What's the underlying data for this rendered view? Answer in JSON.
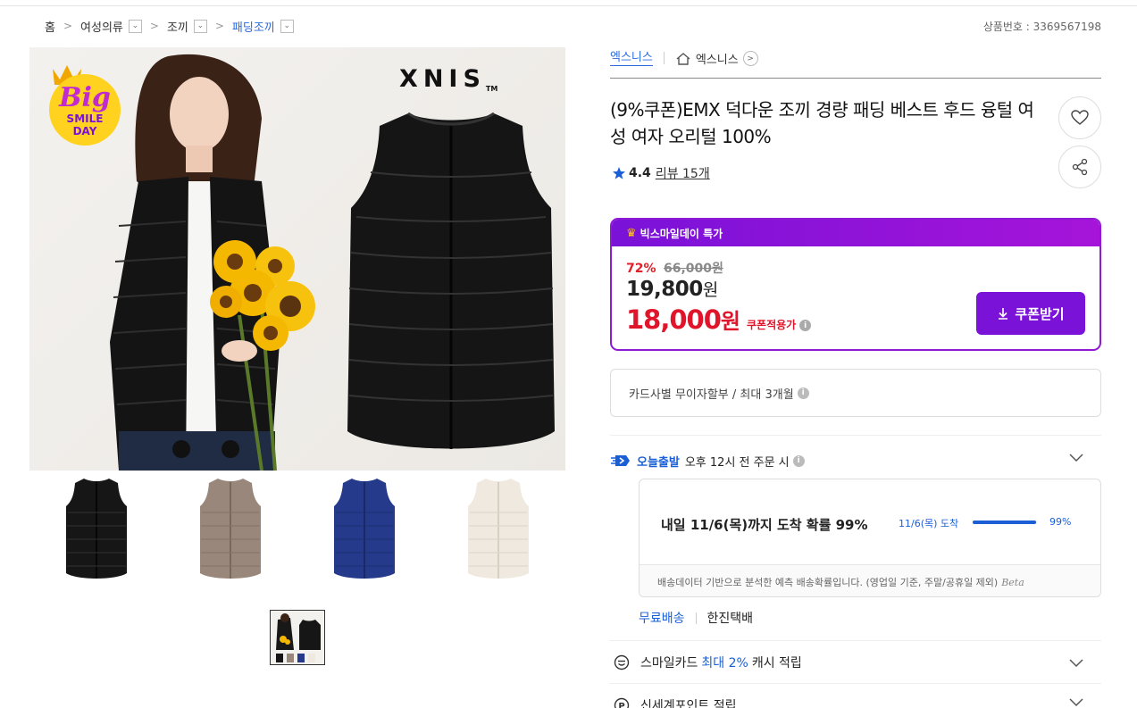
{
  "breadcrumb": {
    "home": "홈",
    "cat1": "여성의류",
    "cat2": "조끼",
    "cat3": "패딩조끼"
  },
  "product_no": "상품번호 : 3369567198",
  "image": {
    "brand": "XNIS",
    "tm": "TM",
    "badge_line1": "Big",
    "badge_line2": "SMILE",
    "badge_line3": "DAY"
  },
  "seller": {
    "shop": "엑스니스",
    "store": "엑스니스"
  },
  "product": {
    "title": "(9%쿠폰)EMX 덕다운 조끼 경량 패딩 베스트 후드 융털 여성 여자 오리털 100%",
    "rating": "4.4",
    "reviews": "리뷰 15개"
  },
  "price": {
    "event": "빅스마일데이 특가",
    "discount_pct": "72%",
    "original": "66,000원",
    "sale_amount": "19,800",
    "sale_unit": "원",
    "coupon_amount": "18,000",
    "coupon_unit": "원",
    "coupon_note": "쿠폰적용가",
    "coupon_button": "쿠폰받기"
  },
  "installment": "카드사별 무이자할부 / 최대 3개월",
  "shipping": {
    "today_label": "오늘출발",
    "cutoff": "오후 12시 전 주문 시",
    "arrival_line": "내일 11/6(목)까지 도착 확률 99%",
    "arrival_short": "11/6(목) 도착",
    "probability": 0.99,
    "probability_label": "99%",
    "note": "배송데이터 기반으로 분석한 예측 배송확률입니다. (영업일 기준, 주말/공휴일 제외)",
    "beta": "Beta",
    "free": "무료배송",
    "carrier": "한진택배"
  },
  "benefits": [
    {
      "pre": "스마일카드",
      "hl": "최대 2%",
      "post": "캐시 적립"
    },
    {
      "pre": "신세계포인트 적립",
      "hl": "",
      "post": ""
    }
  ],
  "variants": [
    "black",
    "taupe",
    "navy",
    "ivory"
  ],
  "colors": {
    "accent_blue": "#1a5fd6",
    "purple": "#7a12d8",
    "sale_red": "#e0142a"
  }
}
